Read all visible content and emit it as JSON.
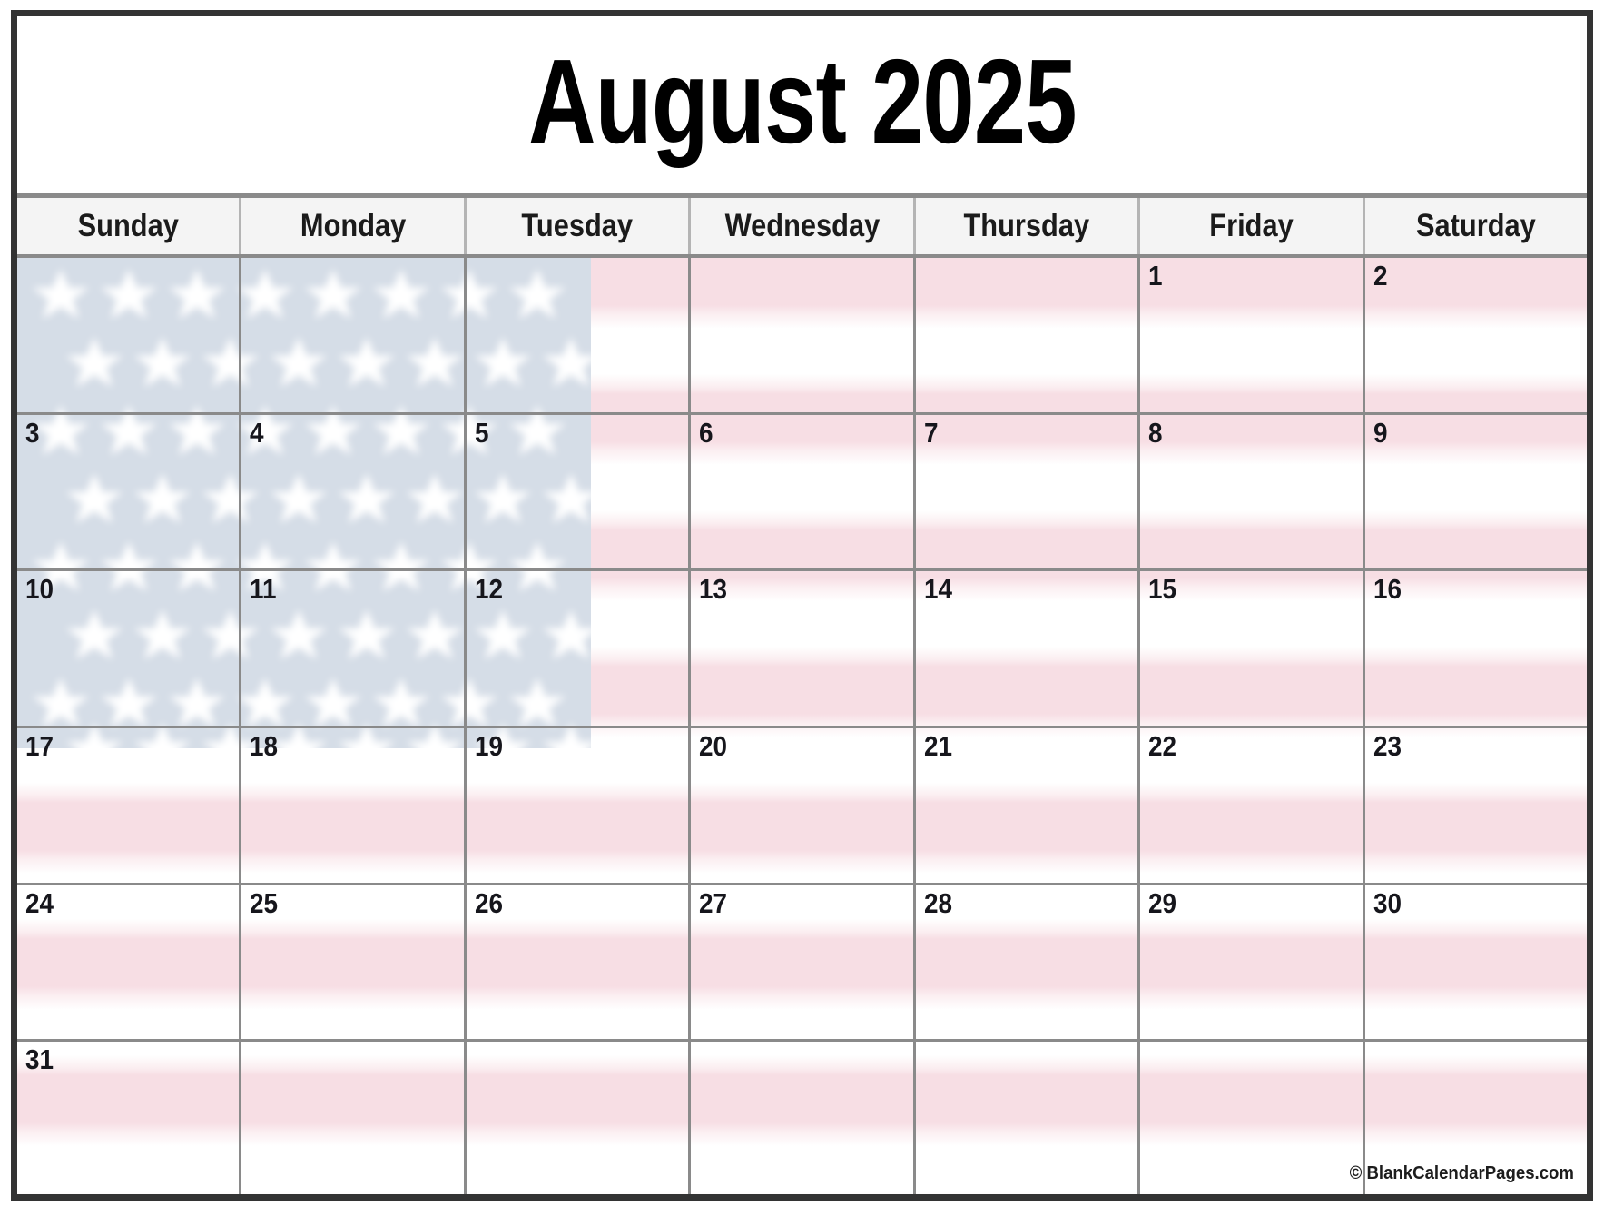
{
  "header": {
    "title": "August 2025",
    "month": "August",
    "year": "2025"
  },
  "weekdays": [
    {
      "label": "Sunday"
    },
    {
      "label": "Monday"
    },
    {
      "label": "Tuesday"
    },
    {
      "label": "Wednesday"
    },
    {
      "label": "Thursday"
    },
    {
      "label": "Friday"
    },
    {
      "label": "Saturday"
    }
  ],
  "weeks": [
    {
      "days": [
        {
          "number": ""
        },
        {
          "number": ""
        },
        {
          "number": ""
        },
        {
          "number": ""
        },
        {
          "number": ""
        },
        {
          "number": "1"
        },
        {
          "number": "2"
        }
      ]
    },
    {
      "days": [
        {
          "number": "3"
        },
        {
          "number": "4"
        },
        {
          "number": "5"
        },
        {
          "number": "6"
        },
        {
          "number": "7"
        },
        {
          "number": "8"
        },
        {
          "number": "9"
        }
      ]
    },
    {
      "days": [
        {
          "number": "10"
        },
        {
          "number": "11"
        },
        {
          "number": "12"
        },
        {
          "number": "13"
        },
        {
          "number": "14"
        },
        {
          "number": "15"
        },
        {
          "number": "16"
        }
      ]
    },
    {
      "days": [
        {
          "number": "17"
        },
        {
          "number": "18"
        },
        {
          "number": "19"
        },
        {
          "number": "20"
        },
        {
          "number": "21"
        },
        {
          "number": "22"
        },
        {
          "number": "23"
        }
      ]
    },
    {
      "days": [
        {
          "number": "24"
        },
        {
          "number": "25"
        },
        {
          "number": "26"
        },
        {
          "number": "27"
        },
        {
          "number": "28"
        },
        {
          "number": "29"
        },
        {
          "number": "30"
        }
      ]
    },
    {
      "days": [
        {
          "number": "31"
        },
        {
          "number": ""
        },
        {
          "number": ""
        },
        {
          "number": ""
        },
        {
          "number": ""
        },
        {
          "number": ""
        },
        {
          "number": ""
        }
      ]
    }
  ],
  "background": {
    "theme": "usa-flag-faded",
    "stripe_color": "#f7dee4",
    "stripe_alt_color": "#ffffff",
    "canton_color": "#d5dde7",
    "star_color": "#ffffff"
  },
  "colors": {
    "frame_border": "#333333",
    "grid_line": "#8a8a8a",
    "header_background": "#f4f4f4",
    "text": "#16161c"
  },
  "footer": {
    "watermark": "© BlankCalendarPages.com"
  }
}
